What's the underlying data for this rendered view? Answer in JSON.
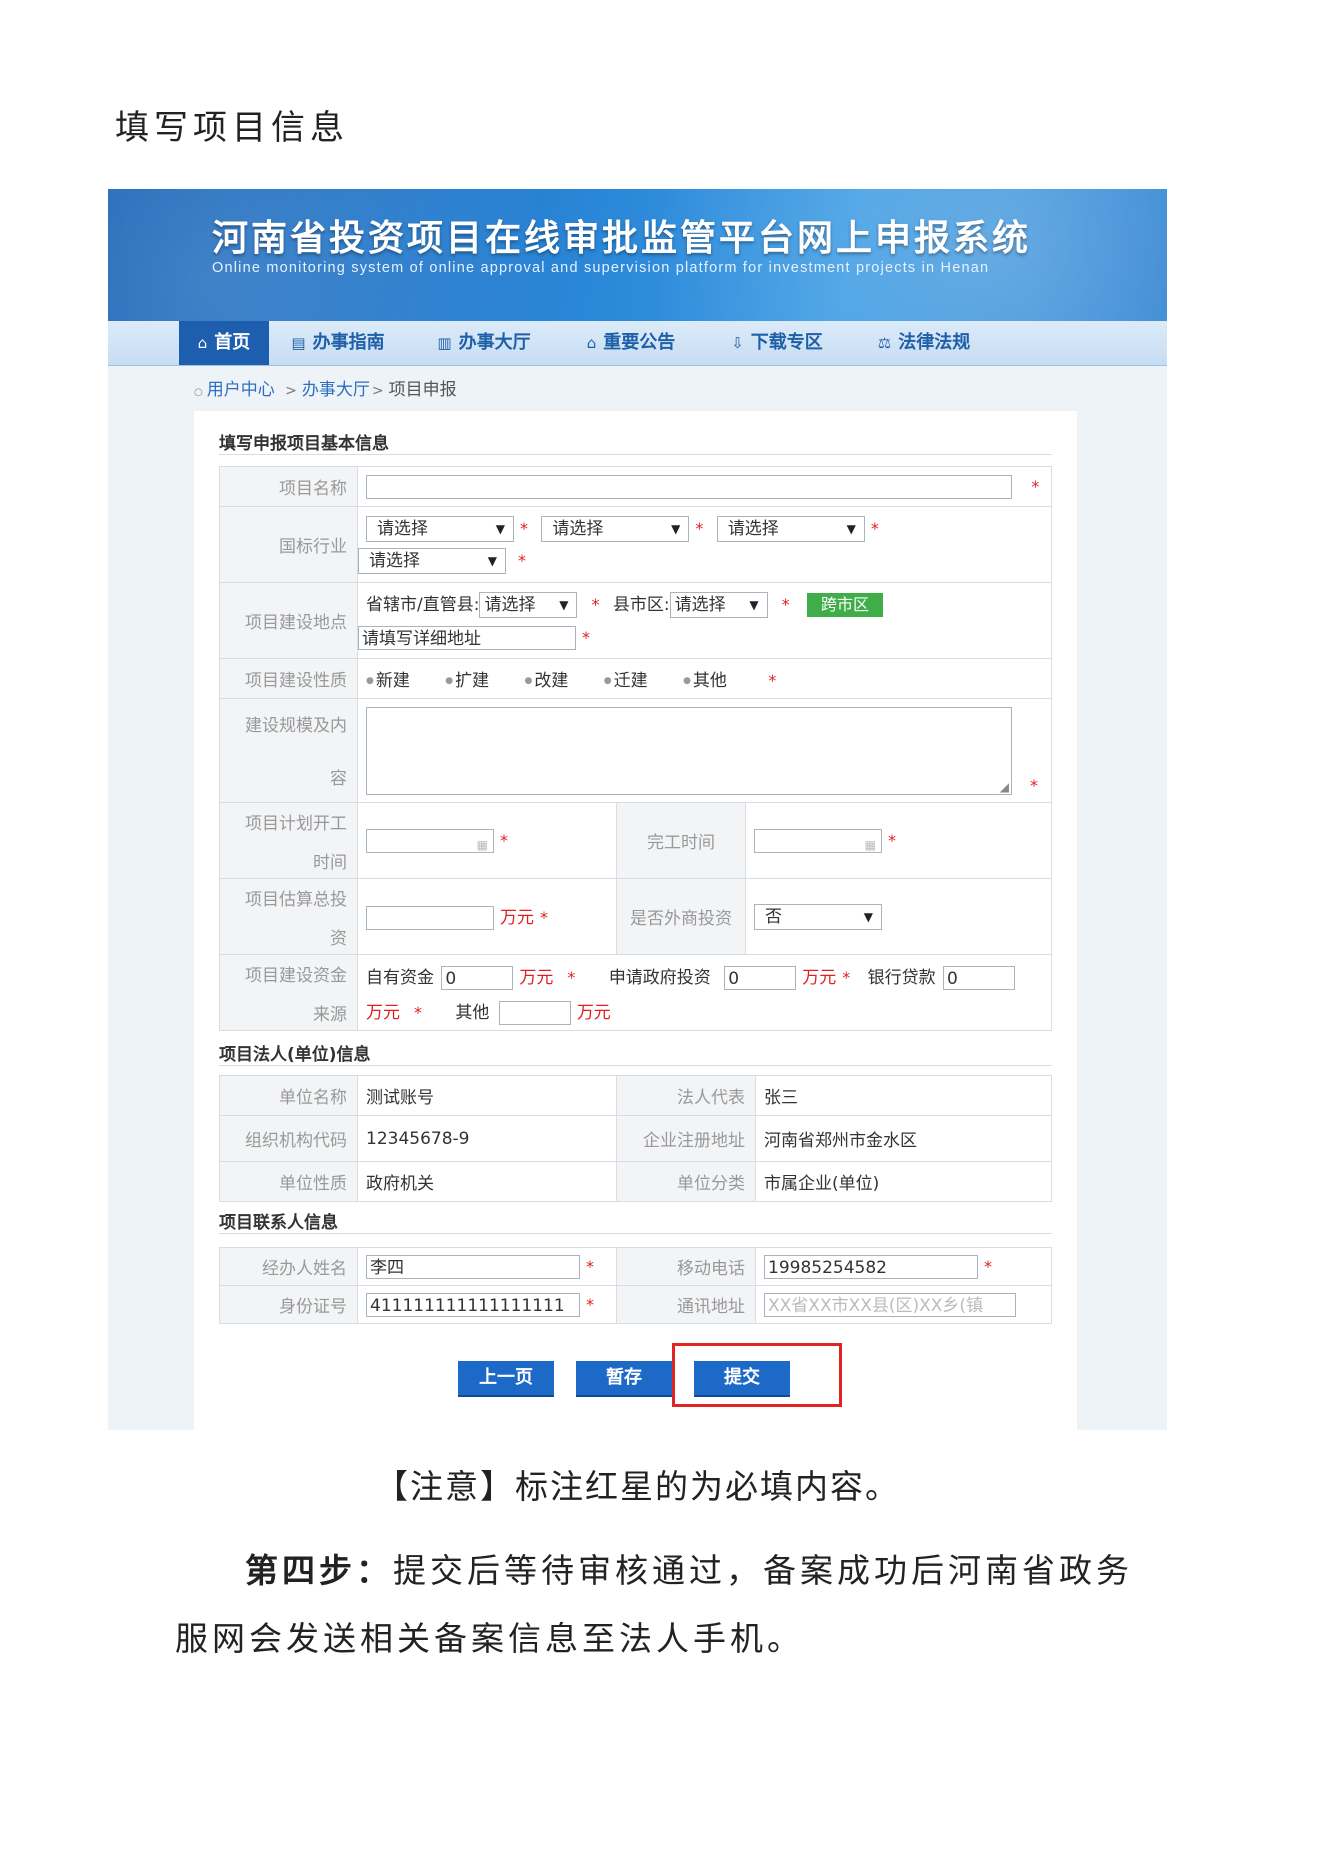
{
  "doc": {
    "heading": "填写项目信息",
    "note": "【注意】标注红星的为必填内容。",
    "step_label": "第四步：",
    "step_text": "提交后等待审核通过，备案成功后河南省政务",
    "step_text2": "服网会发送相关备案信息至法人手机。"
  },
  "header": {
    "title": "河南省投资项目在线审批监管平台网上申报系统",
    "subtitle": "Online monitoring system of online approval and supervision platform for investment projects in Henan"
  },
  "nav": {
    "items": [
      {
        "label": "首页",
        "icon": "home-icon",
        "glyph": "⌂"
      },
      {
        "label": "办事指南",
        "icon": "document-icon",
        "glyph": "▤"
      },
      {
        "label": "办事大厅",
        "icon": "building-icon",
        "glyph": "▥"
      },
      {
        "label": "重要公告",
        "icon": "notice-icon",
        "glyph": "⌂"
      },
      {
        "label": "下载专区",
        "icon": "download-icon",
        "glyph": "⇩"
      },
      {
        "label": "法律法规",
        "icon": "law-icon",
        "glyph": "⚖"
      }
    ]
  },
  "breadcrumb": {
    "bullet": "○",
    "item1": "用户中心",
    "sep": ">",
    "item2": "办事大厅",
    "current": "项目申报"
  },
  "basic": {
    "section_title": "填写申报项目基本信息",
    "star": "*",
    "project_name_label": "项目名称",
    "industry_label": "国标行业",
    "select_placeholder": "请选择",
    "location_label": "项目建设地点",
    "city_label": "省辖市/直管县:",
    "county_label": "县市区:",
    "cross_city_btn": "跨市区",
    "address_placeholder": "请填写详细地址",
    "nature_label": "项目建设性质",
    "nature_options": [
      "新建",
      "扩建",
      "改建",
      "迁建",
      "其他"
    ],
    "scale_label_1": "建设规模及内",
    "scale_label_2": "容",
    "start_label_1": "项目计划开工",
    "start_label_2": "时间",
    "finish_label": "完工时间",
    "invest_label_1": "项目估算总投",
    "invest_label_2": "资",
    "unit": "万元",
    "foreign_label": "是否外商投资",
    "foreign_value": "否",
    "fund_label_1": "项目建设资金",
    "fund_label_2": "来源",
    "own_fund_label": "自有资金",
    "own_fund_value": "0",
    "gov_invest_label": "申请政府投资",
    "gov_invest_value": "0",
    "bank_loan_label": "银行贷款",
    "bank_loan_value": "0",
    "other_label": "其他"
  },
  "legal": {
    "section_title": "项目法人(单位)信息",
    "unit_name_label": "单位名称",
    "unit_name_value": "测试账号",
    "rep_label": "法人代表",
    "rep_value": "张三",
    "org_code_label": "组织机构代码",
    "org_code_value": "12345678-9",
    "reg_addr_label": "企业注册地址",
    "reg_addr_value": "河南省郑州市金水区",
    "unit_nature_label": "单位性质",
    "unit_nature_value": "政府机关",
    "unit_cat_label": "单位分类",
    "unit_cat_value": "市属企业(单位)"
  },
  "contact": {
    "section_title": "项目联系人信息",
    "name_label": "经办人姓名",
    "name_value": "李四",
    "mobile_label": "移动电话",
    "mobile_value": "19985254582",
    "id_label": "身份证号",
    "id_value": "411111111111111111",
    "addr_label": "通讯地址",
    "addr_placeholder": "XX省XX市XX县(区)XX乡(镇"
  },
  "buttons": {
    "prev": "上一页",
    "save": "暂存",
    "submit": "提交"
  },
  "colors": {
    "accent": "#1c69c7",
    "required": "#e02020",
    "highlight": "#e02323",
    "cross_btn": "#3fae49"
  }
}
